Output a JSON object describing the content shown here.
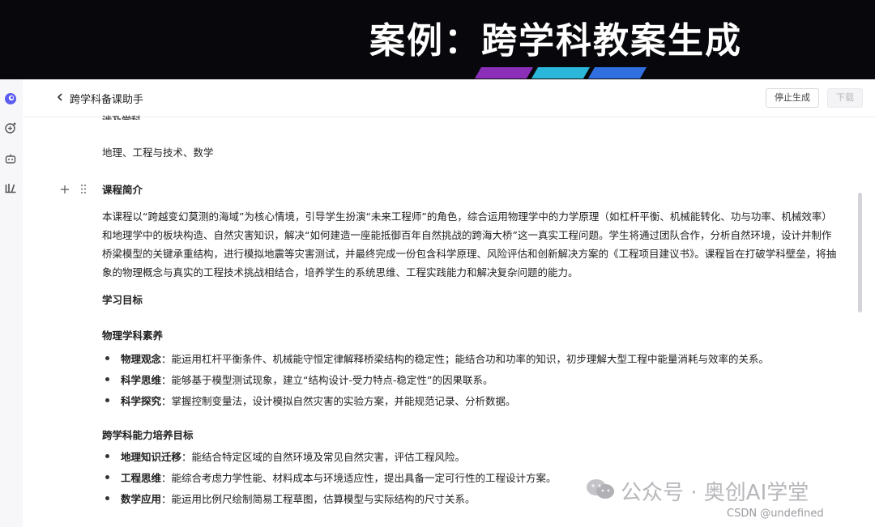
{
  "banner": {
    "title": "案例：跨学科教案生成",
    "stripe_colors": [
      "#8b2fb8",
      "#2bb7d9",
      "#2f6fe0"
    ]
  },
  "sidebar": {
    "icons": [
      "app-logo-icon",
      "new-chat-icon",
      "robot-icon",
      "library-icon"
    ],
    "accent": "#5b5cf0"
  },
  "header": {
    "title": "跨学科备课助手",
    "stop_label": "停止生成",
    "download_label": "下载"
  },
  "document": {
    "cut_heading": "涉及学科",
    "subjects": "地理、工程与技术、数学",
    "intro_heading": "课程简介",
    "intro_text": "本课程以“跨越变幻莫测的海域”为核心情境，引导学生扮演“未来工程师”的角色，综合运用物理学中的力学原理（如杠杆平衡、机械能转化、功与功率、机械效率）和地理学中的板块构造、自然灾害知识，解决“如何建造一座能抵御百年自然挑战的跨海大桥”这一真实工程问题。学生将通过团队合作，分析自然环境，设计并制作桥梁模型的关键承重结构，进行模拟地震等灾害测试，并最终完成一份包含科学原理、风险评估和创新解决方案的《工程项目建议书》。课程旨在打破学科壁垒，将抽象的物理概念与真实的工程技术挑战相结合，培养学生的系统思维、工程实践能力和解决复杂问题的能力。",
    "objectives_heading": "学习目标",
    "physics_heading": "物理学科素养",
    "physics_items": [
      {
        "key": "物理观念",
        "text": "：能运用杠杆平衡条件、机械能守恒定律解释桥梁结构的稳定性；能结合功和功率的知识，初步理解大型工程中能量消耗与效率的关系。"
      },
      {
        "key": "科学思维",
        "text": "：能够基于模型测试现象，建立“结构设计-受力特点-稳定性”的因果联系。"
      },
      {
        "key": "科学探究",
        "text": "：掌握控制变量法，设计模拟自然灾害的实验方案，并能规范记录、分析数据。"
      }
    ],
    "cross_heading": "跨学科能力培养目标",
    "cross_items": [
      {
        "key": "地理知识迁移",
        "text": "：能结合特定区域的自然环境及常见自然灾害，评估工程风险。"
      },
      {
        "key": "工程思维",
        "text": "：能综合考虑力学性能、材料成本与环境适应性，提出具备一定可行性的工程设计方案。"
      },
      {
        "key": "数学应用",
        "text": "：能运用比例尺绘制简易工程草图，估算模型与实际结构的尺寸关系。"
      }
    ]
  },
  "watermark": {
    "text": "公众号 · 奥创AI学堂",
    "csdn": "CSDN @undefined"
  }
}
